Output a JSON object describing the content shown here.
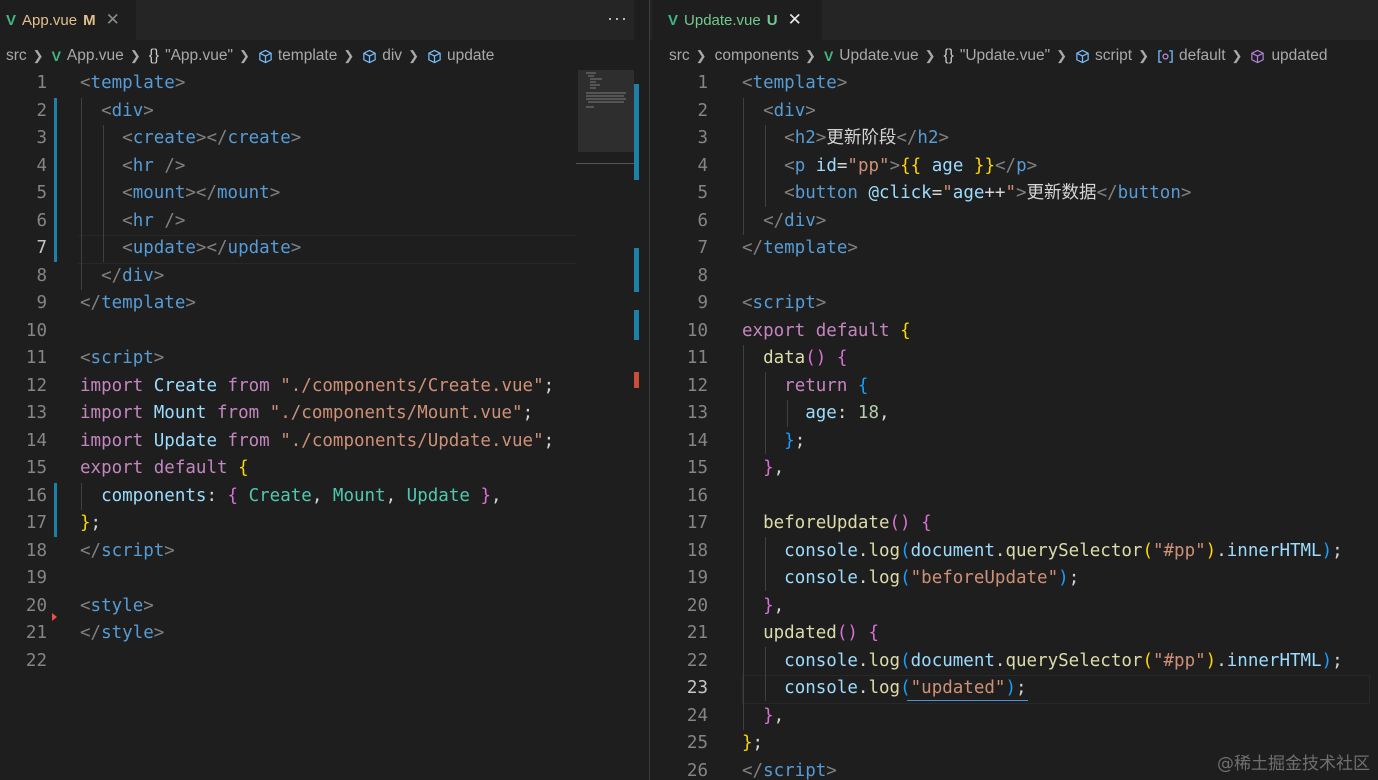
{
  "left": {
    "tab": {
      "label": "App.vue",
      "status": "M",
      "close": "✕"
    },
    "more": "···",
    "breadcrumb": [
      "src",
      "App.vue",
      "\"App.vue\"",
      "template",
      "div",
      "update"
    ],
    "lines": [
      [
        [
          "t",
          "<"
        ],
        [
          "tg",
          "template"
        ],
        [
          "t",
          ">"
        ]
      ],
      [
        [
          "pl",
          "  "
        ],
        [
          "t",
          "<"
        ],
        [
          "tg",
          "div"
        ],
        [
          "t",
          ">"
        ]
      ],
      [
        [
          "pl",
          "    "
        ],
        [
          "t",
          "<"
        ],
        [
          "tg",
          "create"
        ],
        [
          "t",
          "></"
        ],
        [
          "tg",
          "create"
        ],
        [
          "t",
          ">"
        ]
      ],
      [
        [
          "pl",
          "    "
        ],
        [
          "t",
          "<"
        ],
        [
          "tg",
          "hr"
        ],
        [
          "pl",
          " "
        ],
        [
          "t",
          "/>"
        ]
      ],
      [
        [
          "pl",
          "    "
        ],
        [
          "t",
          "<"
        ],
        [
          "tg",
          "mount"
        ],
        [
          "t",
          "></"
        ],
        [
          "tg",
          "mount"
        ],
        [
          "t",
          ">"
        ]
      ],
      [
        [
          "pl",
          "    "
        ],
        [
          "t",
          "<"
        ],
        [
          "tg",
          "hr"
        ],
        [
          "pl",
          " "
        ],
        [
          "t",
          "/>"
        ]
      ],
      [
        [
          "pl",
          "    "
        ],
        [
          "t",
          "<"
        ],
        [
          "tg",
          "update"
        ],
        [
          "t",
          "></"
        ],
        [
          "tg",
          "update"
        ],
        [
          "t",
          ">"
        ]
      ],
      [
        [
          "pl",
          "  "
        ],
        [
          "t",
          "</"
        ],
        [
          "tg",
          "div"
        ],
        [
          "t",
          ">"
        ]
      ],
      [
        [
          "t",
          "</"
        ],
        [
          "tg",
          "template"
        ],
        [
          "t",
          ">"
        ]
      ],
      [],
      [
        [
          "t",
          "<"
        ],
        [
          "tg",
          "script"
        ],
        [
          "t",
          ">"
        ]
      ],
      [
        [
          "kw",
          "import"
        ],
        [
          "pl",
          " "
        ],
        [
          "vr",
          "Create"
        ],
        [
          "pl",
          " "
        ],
        [
          "kw",
          "from"
        ],
        [
          "pl",
          " "
        ],
        [
          "st",
          "\"./components/Create.vue\""
        ],
        [
          "pl",
          ";"
        ]
      ],
      [
        [
          "kw",
          "import"
        ],
        [
          "pl",
          " "
        ],
        [
          "vr",
          "Mount"
        ],
        [
          "pl",
          " "
        ],
        [
          "kw",
          "from"
        ],
        [
          "pl",
          " "
        ],
        [
          "st",
          "\"./components/Mount.vue\""
        ],
        [
          "pl",
          ";"
        ]
      ],
      [
        [
          "kw",
          "import"
        ],
        [
          "pl",
          " "
        ],
        [
          "vr",
          "Update"
        ],
        [
          "pl",
          " "
        ],
        [
          "kw",
          "from"
        ],
        [
          "pl",
          " "
        ],
        [
          "st",
          "\"./components/Update.vue\""
        ],
        [
          "pl",
          ";"
        ]
      ],
      [
        [
          "kw",
          "export"
        ],
        [
          "pl",
          " "
        ],
        [
          "kw",
          "default"
        ],
        [
          "pl",
          " "
        ],
        [
          "br1",
          "{"
        ]
      ],
      [
        [
          "pl",
          "  "
        ],
        [
          "vr",
          "components"
        ],
        [
          "pl",
          ": "
        ],
        [
          "br2",
          "{"
        ],
        [
          "pl",
          " "
        ],
        [
          "cls",
          "Create"
        ],
        [
          "pl",
          ", "
        ],
        [
          "cls",
          "Mount"
        ],
        [
          "pl",
          ", "
        ],
        [
          "cls",
          "Update"
        ],
        [
          "pl",
          " "
        ],
        [
          "br2",
          "}"
        ],
        [
          "pl",
          ","
        ]
      ],
      [
        [
          "br1",
          "}"
        ],
        [
          "pl",
          ";"
        ]
      ],
      [
        [
          "t",
          "</"
        ],
        [
          "tg",
          "script"
        ],
        [
          "t",
          ">"
        ]
      ],
      [],
      [
        [
          "t",
          "<"
        ],
        [
          "tg",
          "style"
        ],
        [
          "t",
          ">"
        ]
      ],
      [
        [
          "t",
          "</"
        ],
        [
          "tg",
          "style"
        ],
        [
          "t",
          ">"
        ]
      ],
      []
    ],
    "active_line": 7
  },
  "right": {
    "tab": {
      "label": "Update.vue",
      "status": "U",
      "close": "✕"
    },
    "breadcrumb": [
      "src",
      "components",
      "Update.vue",
      "\"Update.vue\"",
      "script",
      "default",
      "updated"
    ],
    "lines": [
      [
        [
          "t",
          "<"
        ],
        [
          "tg",
          "template"
        ],
        [
          "t",
          ">"
        ]
      ],
      [
        [
          "pl",
          "  "
        ],
        [
          "t",
          "<"
        ],
        [
          "tg",
          "div"
        ],
        [
          "t",
          ">"
        ]
      ],
      [
        [
          "pl",
          "    "
        ],
        [
          "t",
          "<"
        ],
        [
          "tg",
          "h2"
        ],
        [
          "t",
          ">"
        ],
        [
          "pl",
          "更新阶段"
        ],
        [
          "t",
          "</"
        ],
        [
          "tg",
          "h2"
        ],
        [
          "t",
          ">"
        ]
      ],
      [
        [
          "pl",
          "    "
        ],
        [
          "t",
          "<"
        ],
        [
          "tg",
          "p"
        ],
        [
          "pl",
          " "
        ],
        [
          "at",
          "id"
        ],
        [
          "pl",
          "="
        ],
        [
          "st",
          "\"pp\""
        ],
        [
          "t",
          ">"
        ],
        [
          "br1",
          "{{"
        ],
        [
          "pl",
          " "
        ],
        [
          "vr",
          "age"
        ],
        [
          "pl",
          " "
        ],
        [
          "br1",
          "}}"
        ],
        [
          "t",
          "</"
        ],
        [
          "tg",
          "p"
        ],
        [
          "t",
          ">"
        ]
      ],
      [
        [
          "pl",
          "    "
        ],
        [
          "t",
          "<"
        ],
        [
          "tg",
          "button"
        ],
        [
          "pl",
          " "
        ],
        [
          "at",
          "@click"
        ],
        [
          "pl",
          "="
        ],
        [
          "st",
          "\""
        ],
        [
          "vr",
          "age"
        ],
        [
          "pl",
          "++"
        ],
        [
          "st",
          "\""
        ],
        [
          "t",
          ">"
        ],
        [
          "pl",
          "更新数据"
        ],
        [
          "t",
          "</"
        ],
        [
          "tg",
          "button"
        ],
        [
          "t",
          ">"
        ]
      ],
      [
        [
          "pl",
          "  "
        ],
        [
          "t",
          "</"
        ],
        [
          "tg",
          "div"
        ],
        [
          "t",
          ">"
        ]
      ],
      [
        [
          "t",
          "</"
        ],
        [
          "tg",
          "template"
        ],
        [
          "t",
          ">"
        ]
      ],
      [],
      [
        [
          "t",
          "<"
        ],
        [
          "tg",
          "script"
        ],
        [
          "t",
          ">"
        ]
      ],
      [
        [
          "kw",
          "export"
        ],
        [
          "pl",
          " "
        ],
        [
          "kw",
          "default"
        ],
        [
          "pl",
          " "
        ],
        [
          "br1",
          "{"
        ]
      ],
      [
        [
          "pl",
          "  "
        ],
        [
          "fn",
          "data"
        ],
        [
          "br2",
          "()"
        ],
        [
          "pl",
          " "
        ],
        [
          "br2",
          "{"
        ]
      ],
      [
        [
          "pl",
          "    "
        ],
        [
          "kw",
          "return"
        ],
        [
          "pl",
          " "
        ],
        [
          "br3",
          "{"
        ]
      ],
      [
        [
          "pl",
          "      "
        ],
        [
          "vr",
          "age"
        ],
        [
          "pl",
          ": "
        ],
        [
          "num",
          "18"
        ],
        [
          "pl",
          ","
        ]
      ],
      [
        [
          "pl",
          "    "
        ],
        [
          "br3",
          "}"
        ],
        [
          "pl",
          ";"
        ]
      ],
      [
        [
          "pl",
          "  "
        ],
        [
          "br2",
          "}"
        ],
        [
          "pl",
          ","
        ]
      ],
      [],
      [
        [
          "pl",
          "  "
        ],
        [
          "fn",
          "beforeUpdate"
        ],
        [
          "br2",
          "()"
        ],
        [
          "pl",
          " "
        ],
        [
          "br2",
          "{"
        ]
      ],
      [
        [
          "pl",
          "    "
        ],
        [
          "vr",
          "console"
        ],
        [
          "pl",
          "."
        ],
        [
          "fn",
          "log"
        ],
        [
          "br3",
          "("
        ],
        [
          "vr",
          "document"
        ],
        [
          "pl",
          "."
        ],
        [
          "fn",
          "querySelector"
        ],
        [
          "br1",
          "("
        ],
        [
          "st",
          "\"#pp\""
        ],
        [
          "br1",
          ")"
        ],
        [
          "pl",
          "."
        ],
        [
          "vr",
          "innerHTML"
        ],
        [
          "br3",
          ")"
        ],
        [
          "pl",
          ";"
        ]
      ],
      [
        [
          "pl",
          "    "
        ],
        [
          "vr",
          "console"
        ],
        [
          "pl",
          "."
        ],
        [
          "fn",
          "log"
        ],
        [
          "br3",
          "("
        ],
        [
          "st",
          "\"beforeUpdate\""
        ],
        [
          "br3",
          ")"
        ],
        [
          "pl",
          ";"
        ]
      ],
      [
        [
          "pl",
          "  "
        ],
        [
          "br2",
          "}"
        ],
        [
          "pl",
          ","
        ]
      ],
      [
        [
          "pl",
          "  "
        ],
        [
          "fn",
          "updated"
        ],
        [
          "br2",
          "()"
        ],
        [
          "pl",
          " "
        ],
        [
          "br2",
          "{"
        ]
      ],
      [
        [
          "pl",
          "    "
        ],
        [
          "vr",
          "console"
        ],
        [
          "pl",
          "."
        ],
        [
          "fn",
          "log"
        ],
        [
          "br3",
          "("
        ],
        [
          "vr",
          "document"
        ],
        [
          "pl",
          "."
        ],
        [
          "fn",
          "querySelector"
        ],
        [
          "br1",
          "("
        ],
        [
          "st",
          "\"#pp\""
        ],
        [
          "br1",
          ")"
        ],
        [
          "pl",
          "."
        ],
        [
          "vr",
          "innerHTML"
        ],
        [
          "br3",
          ")"
        ],
        [
          "pl",
          ";"
        ]
      ],
      [
        [
          "pl",
          "    "
        ],
        [
          "vr",
          "console"
        ],
        [
          "pl",
          "."
        ],
        [
          "fn",
          "log"
        ],
        [
          "br3",
          "("
        ],
        [
          "st",
          "\"updated\""
        ],
        [
          "br3",
          ")"
        ],
        [
          "pl",
          ";"
        ]
      ],
      [
        [
          "pl",
          "  "
        ],
        [
          "br2",
          "}"
        ],
        [
          "pl",
          ","
        ]
      ],
      [
        [
          "br1",
          "}"
        ],
        [
          "pl",
          ";"
        ]
      ],
      [
        [
          "t",
          "</"
        ],
        [
          "tg",
          "script"
        ],
        [
          "t",
          ">"
        ]
      ]
    ],
    "active_line": 23
  },
  "watermark": "@稀土掘金技术社区",
  "icons": {
    "vue": "vue-file-icon",
    "close": "close-icon",
    "braces": "json-braces-icon",
    "cube": "symbol-cube-icon",
    "namespace": "symbol-namespace-icon",
    "method": "symbol-method-icon"
  },
  "colors": {
    "background": "#1e1e1e",
    "tabbar": "#252526",
    "modified": "#e2c08d",
    "untracked": "#73c991",
    "vue": "#41b883"
  }
}
